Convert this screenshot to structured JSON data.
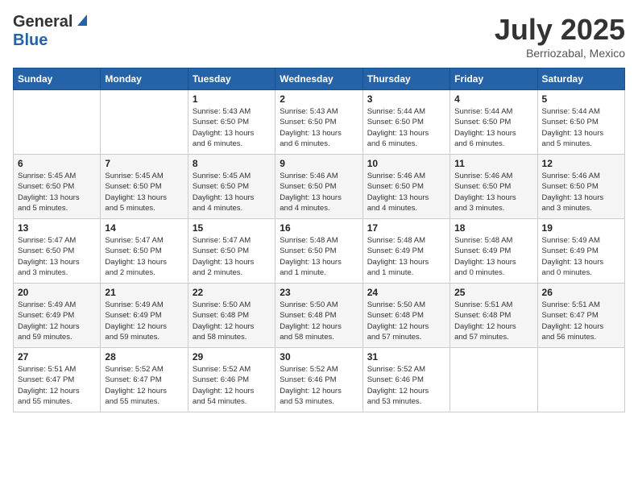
{
  "header": {
    "logo_general": "General",
    "logo_blue": "Blue",
    "month_title": "July 2025",
    "location": "Berriozabal, Mexico"
  },
  "days_of_week": [
    "Sunday",
    "Monday",
    "Tuesday",
    "Wednesday",
    "Thursday",
    "Friday",
    "Saturday"
  ],
  "weeks": [
    {
      "cells": [
        {
          "day": "",
          "info": ""
        },
        {
          "day": "",
          "info": ""
        },
        {
          "day": "1",
          "info": "Sunrise: 5:43 AM\nSunset: 6:50 PM\nDaylight: 13 hours\nand 6 minutes."
        },
        {
          "day": "2",
          "info": "Sunrise: 5:43 AM\nSunset: 6:50 PM\nDaylight: 13 hours\nand 6 minutes."
        },
        {
          "day": "3",
          "info": "Sunrise: 5:44 AM\nSunset: 6:50 PM\nDaylight: 13 hours\nand 6 minutes."
        },
        {
          "day": "4",
          "info": "Sunrise: 5:44 AM\nSunset: 6:50 PM\nDaylight: 13 hours\nand 6 minutes."
        },
        {
          "day": "5",
          "info": "Sunrise: 5:44 AM\nSunset: 6:50 PM\nDaylight: 13 hours\nand 5 minutes."
        }
      ]
    },
    {
      "cells": [
        {
          "day": "6",
          "info": "Sunrise: 5:45 AM\nSunset: 6:50 PM\nDaylight: 13 hours\nand 5 minutes."
        },
        {
          "day": "7",
          "info": "Sunrise: 5:45 AM\nSunset: 6:50 PM\nDaylight: 13 hours\nand 5 minutes."
        },
        {
          "day": "8",
          "info": "Sunrise: 5:45 AM\nSunset: 6:50 PM\nDaylight: 13 hours\nand 4 minutes."
        },
        {
          "day": "9",
          "info": "Sunrise: 5:46 AM\nSunset: 6:50 PM\nDaylight: 13 hours\nand 4 minutes."
        },
        {
          "day": "10",
          "info": "Sunrise: 5:46 AM\nSunset: 6:50 PM\nDaylight: 13 hours\nand 4 minutes."
        },
        {
          "day": "11",
          "info": "Sunrise: 5:46 AM\nSunset: 6:50 PM\nDaylight: 13 hours\nand 3 minutes."
        },
        {
          "day": "12",
          "info": "Sunrise: 5:46 AM\nSunset: 6:50 PM\nDaylight: 13 hours\nand 3 minutes."
        }
      ]
    },
    {
      "cells": [
        {
          "day": "13",
          "info": "Sunrise: 5:47 AM\nSunset: 6:50 PM\nDaylight: 13 hours\nand 3 minutes."
        },
        {
          "day": "14",
          "info": "Sunrise: 5:47 AM\nSunset: 6:50 PM\nDaylight: 13 hours\nand 2 minutes."
        },
        {
          "day": "15",
          "info": "Sunrise: 5:47 AM\nSunset: 6:50 PM\nDaylight: 13 hours\nand 2 minutes."
        },
        {
          "day": "16",
          "info": "Sunrise: 5:48 AM\nSunset: 6:50 PM\nDaylight: 13 hours\nand 1 minute."
        },
        {
          "day": "17",
          "info": "Sunrise: 5:48 AM\nSunset: 6:49 PM\nDaylight: 13 hours\nand 1 minute."
        },
        {
          "day": "18",
          "info": "Sunrise: 5:48 AM\nSunset: 6:49 PM\nDaylight: 13 hours\nand 0 minutes."
        },
        {
          "day": "19",
          "info": "Sunrise: 5:49 AM\nSunset: 6:49 PM\nDaylight: 13 hours\nand 0 minutes."
        }
      ]
    },
    {
      "cells": [
        {
          "day": "20",
          "info": "Sunrise: 5:49 AM\nSunset: 6:49 PM\nDaylight: 12 hours\nand 59 minutes."
        },
        {
          "day": "21",
          "info": "Sunrise: 5:49 AM\nSunset: 6:49 PM\nDaylight: 12 hours\nand 59 minutes."
        },
        {
          "day": "22",
          "info": "Sunrise: 5:50 AM\nSunset: 6:48 PM\nDaylight: 12 hours\nand 58 minutes."
        },
        {
          "day": "23",
          "info": "Sunrise: 5:50 AM\nSunset: 6:48 PM\nDaylight: 12 hours\nand 58 minutes."
        },
        {
          "day": "24",
          "info": "Sunrise: 5:50 AM\nSunset: 6:48 PM\nDaylight: 12 hours\nand 57 minutes."
        },
        {
          "day": "25",
          "info": "Sunrise: 5:51 AM\nSunset: 6:48 PM\nDaylight: 12 hours\nand 57 minutes."
        },
        {
          "day": "26",
          "info": "Sunrise: 5:51 AM\nSunset: 6:47 PM\nDaylight: 12 hours\nand 56 minutes."
        }
      ]
    },
    {
      "cells": [
        {
          "day": "27",
          "info": "Sunrise: 5:51 AM\nSunset: 6:47 PM\nDaylight: 12 hours\nand 55 minutes."
        },
        {
          "day": "28",
          "info": "Sunrise: 5:52 AM\nSunset: 6:47 PM\nDaylight: 12 hours\nand 55 minutes."
        },
        {
          "day": "29",
          "info": "Sunrise: 5:52 AM\nSunset: 6:46 PM\nDaylight: 12 hours\nand 54 minutes."
        },
        {
          "day": "30",
          "info": "Sunrise: 5:52 AM\nSunset: 6:46 PM\nDaylight: 12 hours\nand 53 minutes."
        },
        {
          "day": "31",
          "info": "Sunrise: 5:52 AM\nSunset: 6:46 PM\nDaylight: 12 hours\nand 53 minutes."
        },
        {
          "day": "",
          "info": ""
        },
        {
          "day": "",
          "info": ""
        }
      ]
    }
  ]
}
